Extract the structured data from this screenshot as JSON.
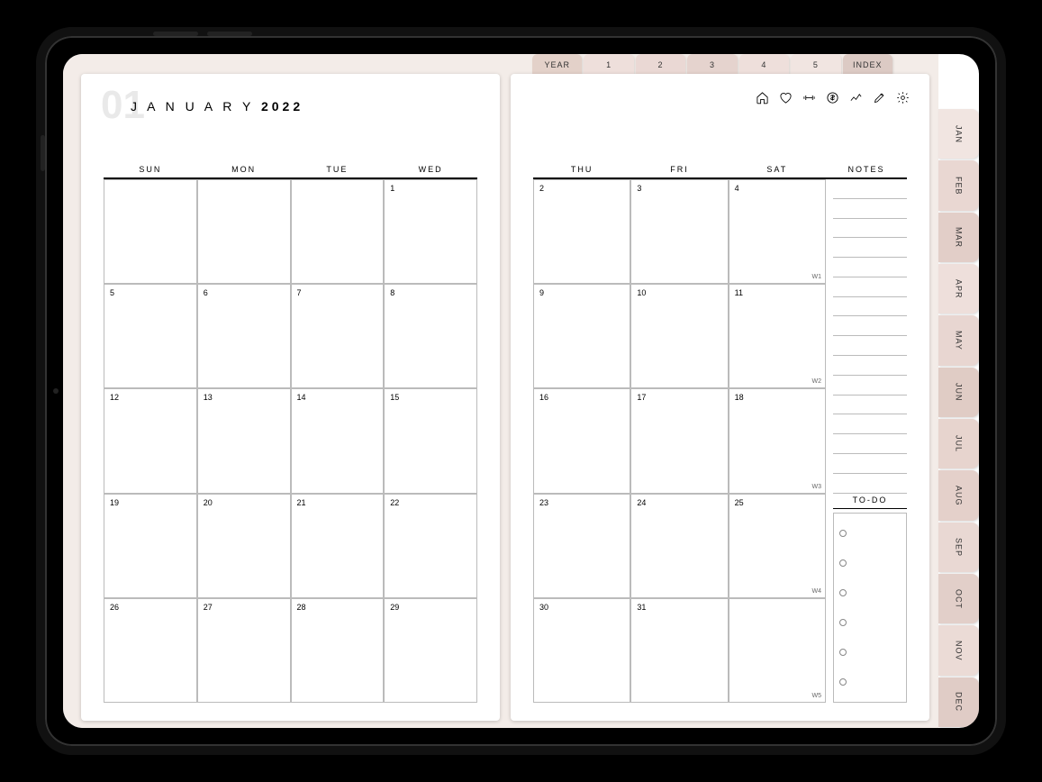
{
  "month_number": "01",
  "month_name": "JANUARY",
  "year": "2022",
  "top_tabs": [
    "YEAR",
    "1",
    "2",
    "3",
    "4",
    "5",
    "INDEX"
  ],
  "top_tab_colors": [
    "#e3d1c9",
    "#eedfdb",
    "#ead8d4",
    "#e5d3ce",
    "#eedfdb",
    "#f1e5e1",
    "#dccac4"
  ],
  "side_tabs": [
    "JAN",
    "FEB",
    "MAR",
    "APR",
    "MAY",
    "JUN",
    "JUL",
    "AUG",
    "SEP",
    "OCT",
    "NOV",
    "DEC"
  ],
  "side_tab_colors": [
    "#f1e5e1",
    "#e9d7d2",
    "#e2cec8",
    "#eedfdb",
    "#e8d6d1",
    "#e0ccc5",
    "#e7d4ce",
    "#e4d0ca",
    "#e9d8d3",
    "#e2cfc9",
    "#ebdbd6",
    "#e0ccc6"
  ],
  "left_headers": [
    "SUN",
    "MON",
    "TUE",
    "WED"
  ],
  "right_headers": [
    "THU",
    "FRI",
    "SAT",
    "NOTES"
  ],
  "todo_title": "TO-DO",
  "todo_count": 6,
  "notes_line_count": 16,
  "icons": [
    "home",
    "heart",
    "fitness",
    "money",
    "progress",
    "edit",
    "settings"
  ],
  "left_cells": [
    [
      "",
      "",
      "",
      "1"
    ],
    [
      "5",
      "6",
      "7",
      "8"
    ],
    [
      "12",
      "13",
      "14",
      "15"
    ],
    [
      "19",
      "20",
      "21",
      "22"
    ],
    [
      "26",
      "27",
      "28",
      "29"
    ]
  ],
  "right_cells": [
    [
      "2",
      "3",
      "4"
    ],
    [
      "9",
      "10",
      "11"
    ],
    [
      "16",
      "17",
      "18"
    ],
    [
      "23",
      "24",
      "25"
    ],
    [
      "30",
      "31",
      ""
    ]
  ],
  "week_labels": [
    "W1",
    "W2",
    "W3",
    "W4",
    "W5"
  ]
}
